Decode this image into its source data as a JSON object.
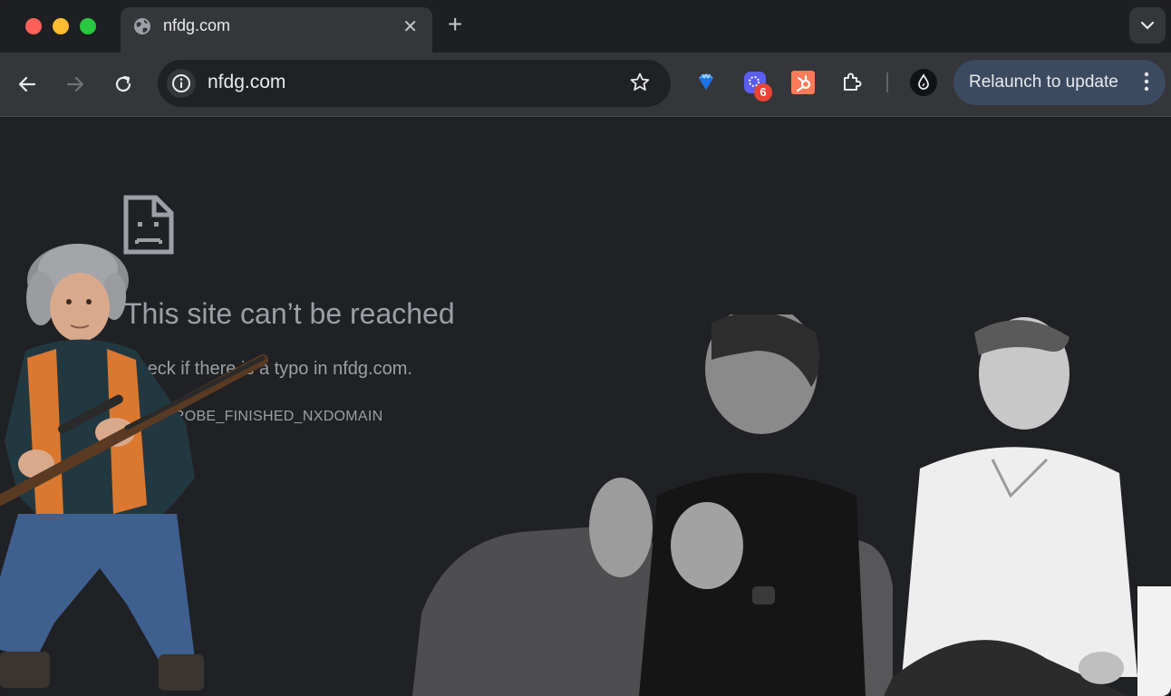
{
  "tab": {
    "title": "nfdg.com"
  },
  "omnibox": {
    "url": "nfdg.com"
  },
  "extensions": {
    "badge_count": "6"
  },
  "relaunch": {
    "label": "Relaunch to update"
  },
  "error": {
    "title": "This site can’t be reached",
    "description_prefix": "Check if there is a typo in ",
    "description_domain": "nfdg.com",
    "description_suffix": ".",
    "code": "DNS_PROBE_FINISHED_NXDOMAIN"
  },
  "colors": {
    "accent_update": "#3c4a60",
    "badge": "#ea4335",
    "page_bg": "#202124"
  }
}
